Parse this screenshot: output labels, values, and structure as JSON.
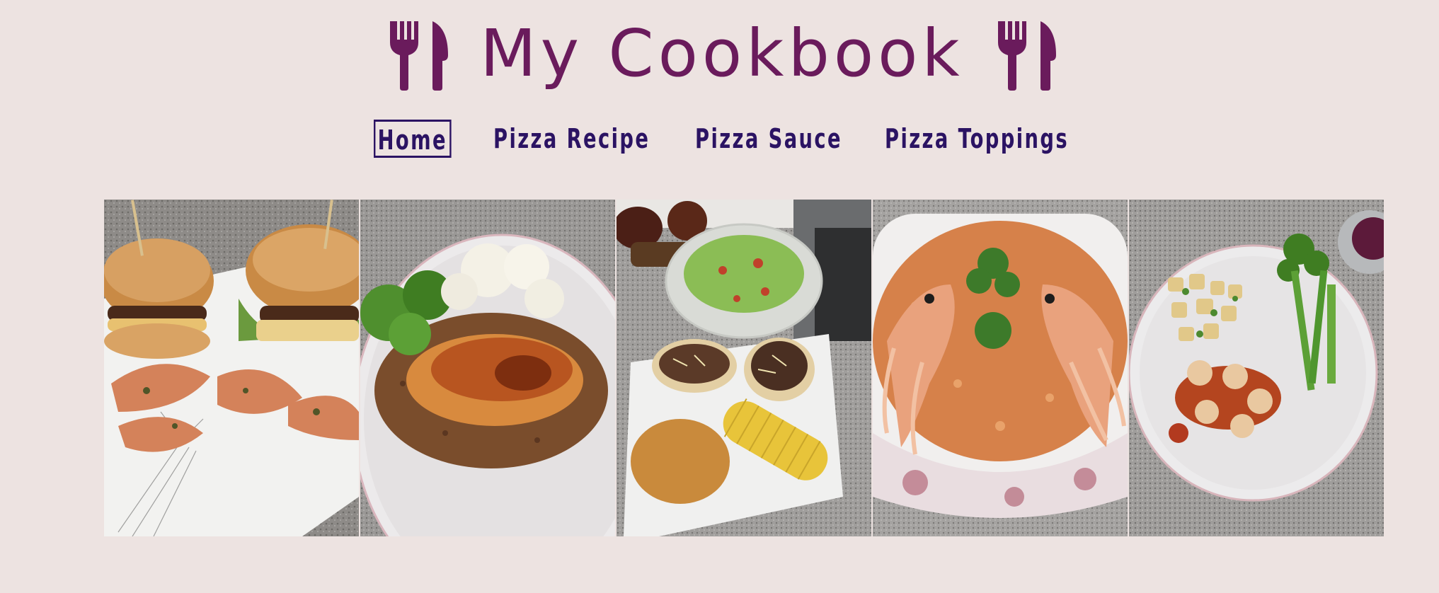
{
  "site": {
    "title": "My Cookbook",
    "brand_color": "#6a1b5c",
    "background_color": "#ede3e1"
  },
  "nav": {
    "items": [
      {
        "label": "Home",
        "active": true
      },
      {
        "label": "Pizza Recipe",
        "active": false
      },
      {
        "label": "Pizza Sauce",
        "active": false
      },
      {
        "label": "Pizza Toppings",
        "active": false
      }
    ],
    "color": "#2b1363"
  },
  "gallery": {
    "photos": [
      {
        "subject": "burgers-and-prawns"
      },
      {
        "subject": "chicken-buckwheat-broccoli-cauliflower"
      },
      {
        "subject": "tacos-rice-corn-salad"
      },
      {
        "subject": "langoustine-risotto"
      },
      {
        "subject": "potatoes-meatballs-broccoli"
      }
    ]
  },
  "icons": {
    "left": "fork-knife-icon",
    "right": "fork-knife-icon"
  }
}
